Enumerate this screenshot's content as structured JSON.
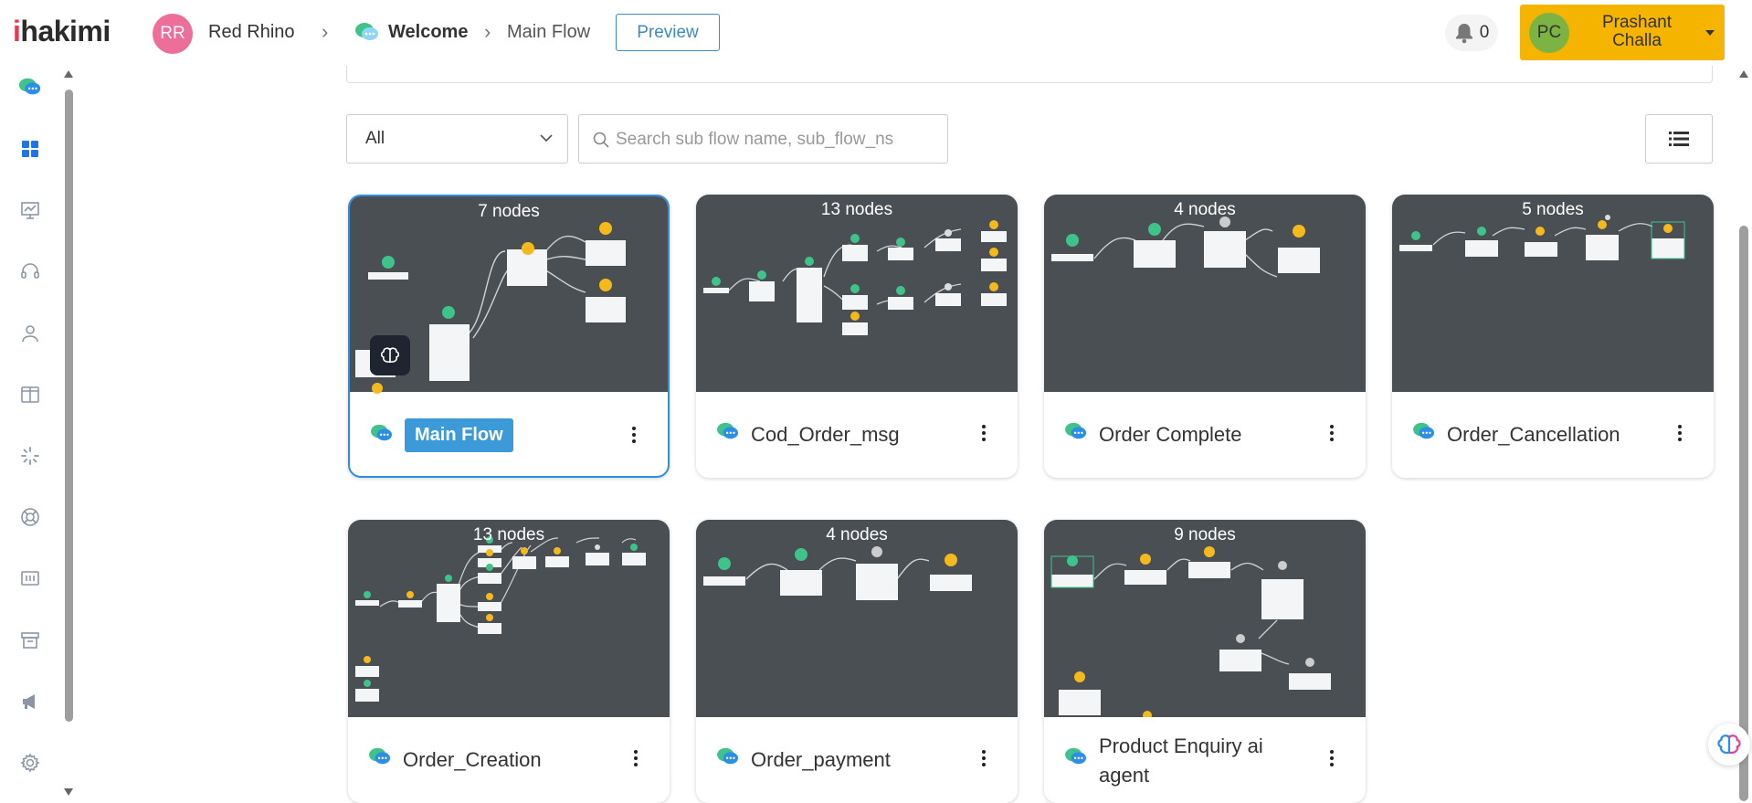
{
  "app": {
    "logo_prefix": "i",
    "logo_rest": "hakimi"
  },
  "workspace": {
    "initials": "RR",
    "name": "Red Rhino"
  },
  "breadcrumb": {
    "parent": "Welcome",
    "current": "Main Flow"
  },
  "toolbar": {
    "preview_label": "Preview"
  },
  "notifications": {
    "count": "0"
  },
  "user": {
    "initials": "PC",
    "first_name": "Prashant",
    "last_name": "Challa"
  },
  "filters": {
    "select_value": "All",
    "search_placeholder": "Search sub flow name, sub_flow_ns"
  },
  "flows": [
    {
      "name": "Main Flow",
      "nodes": "7 nodes",
      "selected": true
    },
    {
      "name": "Cod_Order_msg",
      "nodes": "13 nodes"
    },
    {
      "name": "Order Complete",
      "nodes": "4 nodes"
    },
    {
      "name": "Order_Cancellation",
      "nodes": "5 nodes"
    },
    {
      "name": "Order_Creation",
      "nodes": "13 nodes"
    },
    {
      "name": "Order_payment",
      "nodes": "4 nodes"
    },
    {
      "name": "Product Enquiry ai agent",
      "nodes": "9 nodes"
    }
  ],
  "colors": {
    "accent": "#3c8bc6",
    "user_box": "#f4b400",
    "card_thumb": "#4a4f54",
    "badge": "#3c9ad8",
    "node_green": "#3fc38b",
    "node_yellow": "#f5b91c"
  }
}
